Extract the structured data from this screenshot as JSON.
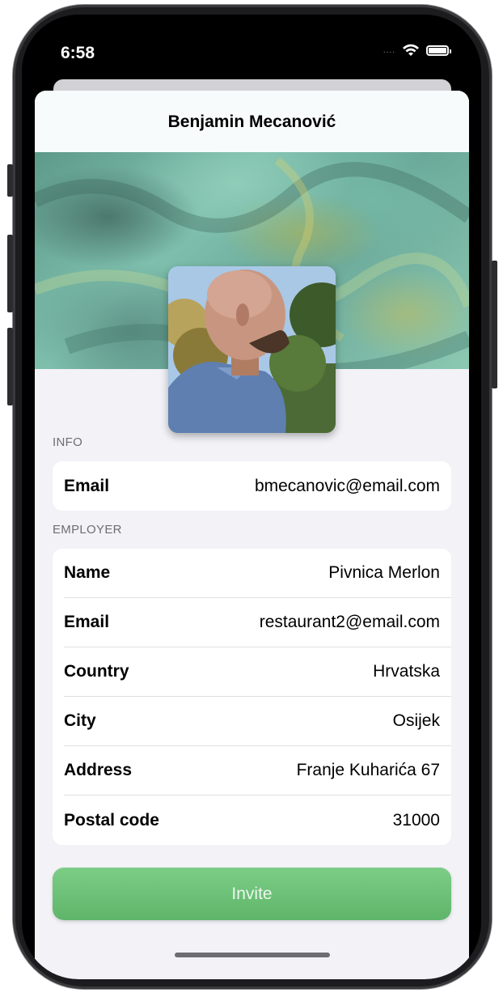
{
  "status_bar": {
    "time": "6:58",
    "signal": "....",
    "wifi_icon": "wifi-icon",
    "battery_icon": "battery-icon"
  },
  "nav": {
    "title": "Benjamin Mecanović"
  },
  "info": {
    "header": "INFO",
    "rows": [
      {
        "label": "Email",
        "value": "bmecanovic@email.com"
      }
    ]
  },
  "employer": {
    "header": "EMPLOYER",
    "rows": [
      {
        "label": "Name",
        "value": "Pivnica Merlon"
      },
      {
        "label": "Email",
        "value": "restaurant2@email.com"
      },
      {
        "label": "Country",
        "value": "Hrvatska"
      },
      {
        "label": "City",
        "value": "Osijek"
      },
      {
        "label": "Address",
        "value": "Franje Kuharića 67"
      },
      {
        "label": "Postal code",
        "value": "31000"
      }
    ]
  },
  "actions": {
    "invite_label": "Invite"
  },
  "colors": {
    "accent": "#6cc178",
    "background": "#f2f2f7"
  }
}
